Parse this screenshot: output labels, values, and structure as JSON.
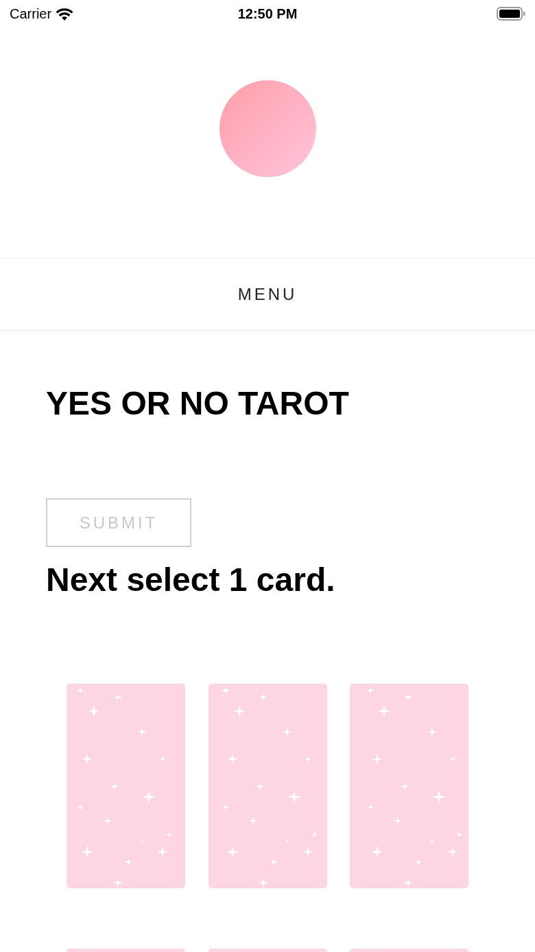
{
  "status_bar": {
    "carrier": "Carrier",
    "time": "12:50 PM"
  },
  "menu": {
    "label": "MENU"
  },
  "title": "YES OR NO TAROT",
  "submit_button": {
    "label": "SUBMIT",
    "disabled": true
  },
  "instruction": "Next select 1 card.",
  "cards": [
    {
      "kind": "card_back"
    },
    {
      "kind": "card_back"
    },
    {
      "kind": "card_back"
    },
    {
      "kind": "card_back"
    },
    {
      "kind": "card_back"
    },
    {
      "kind": "card_back"
    }
  ]
}
